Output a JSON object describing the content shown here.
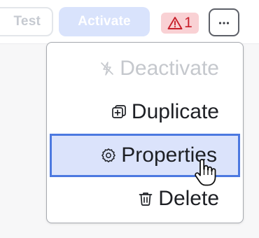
{
  "toolbar": {
    "test_label": "Test",
    "activate_label": "Activate",
    "warning_count": "1",
    "more_icon": "ellipsis-icon"
  },
  "menu": {
    "items": [
      {
        "label": "Deactivate",
        "icon": "deactivate-icon",
        "state": "disabled"
      },
      {
        "label": "Duplicate",
        "icon": "duplicate-icon",
        "state": "normal"
      },
      {
        "label": "Properties",
        "icon": "gear-icon",
        "state": "hovered"
      },
      {
        "label": "Delete",
        "icon": "trash-icon",
        "state": "normal"
      }
    ]
  },
  "colors": {
    "accent": "#4c79e0",
    "hover_bg": "#dbe3fb",
    "warning_bg": "#f9d1d4",
    "warning_fg": "#c8202c",
    "activate_bg": "#d9e3fc"
  }
}
